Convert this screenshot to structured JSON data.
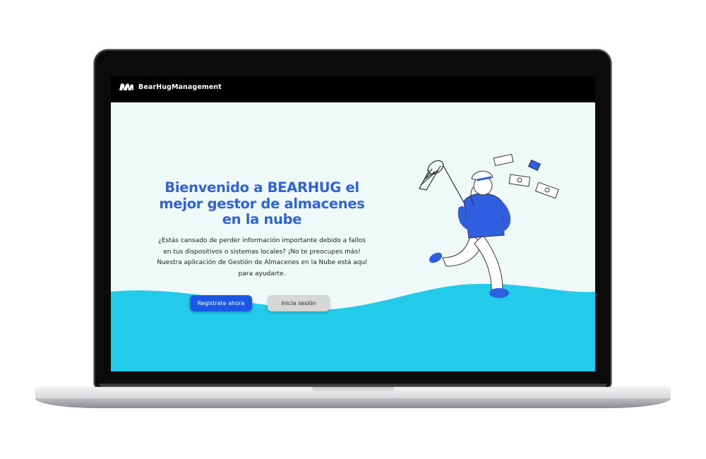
{
  "brand": {
    "name": "BearHugManagement",
    "logo_icon": "bear-logo-icon"
  },
  "hero": {
    "title": "Bienvenido a BEARHUG el mejor gestor de almacenes en la nube",
    "description": "¿Estás cansado de perder información importante debido a fallos en tus dispositivos o sistemas locales? ¡No te preocupes más! Nuestra aplicación de Gestión de Almacenes en la Nube está aquí para ayudarte."
  },
  "actions": {
    "register_label": "Registrate ahora",
    "login_label": "Inicia sesión"
  },
  "colors": {
    "accent": "#2f63dc",
    "primary_button": "#1a57e6",
    "wave": "#22cbe9",
    "screen_bg": "#eef9f8"
  },
  "illustration": {
    "icon": "person-catching-money-illustration"
  }
}
